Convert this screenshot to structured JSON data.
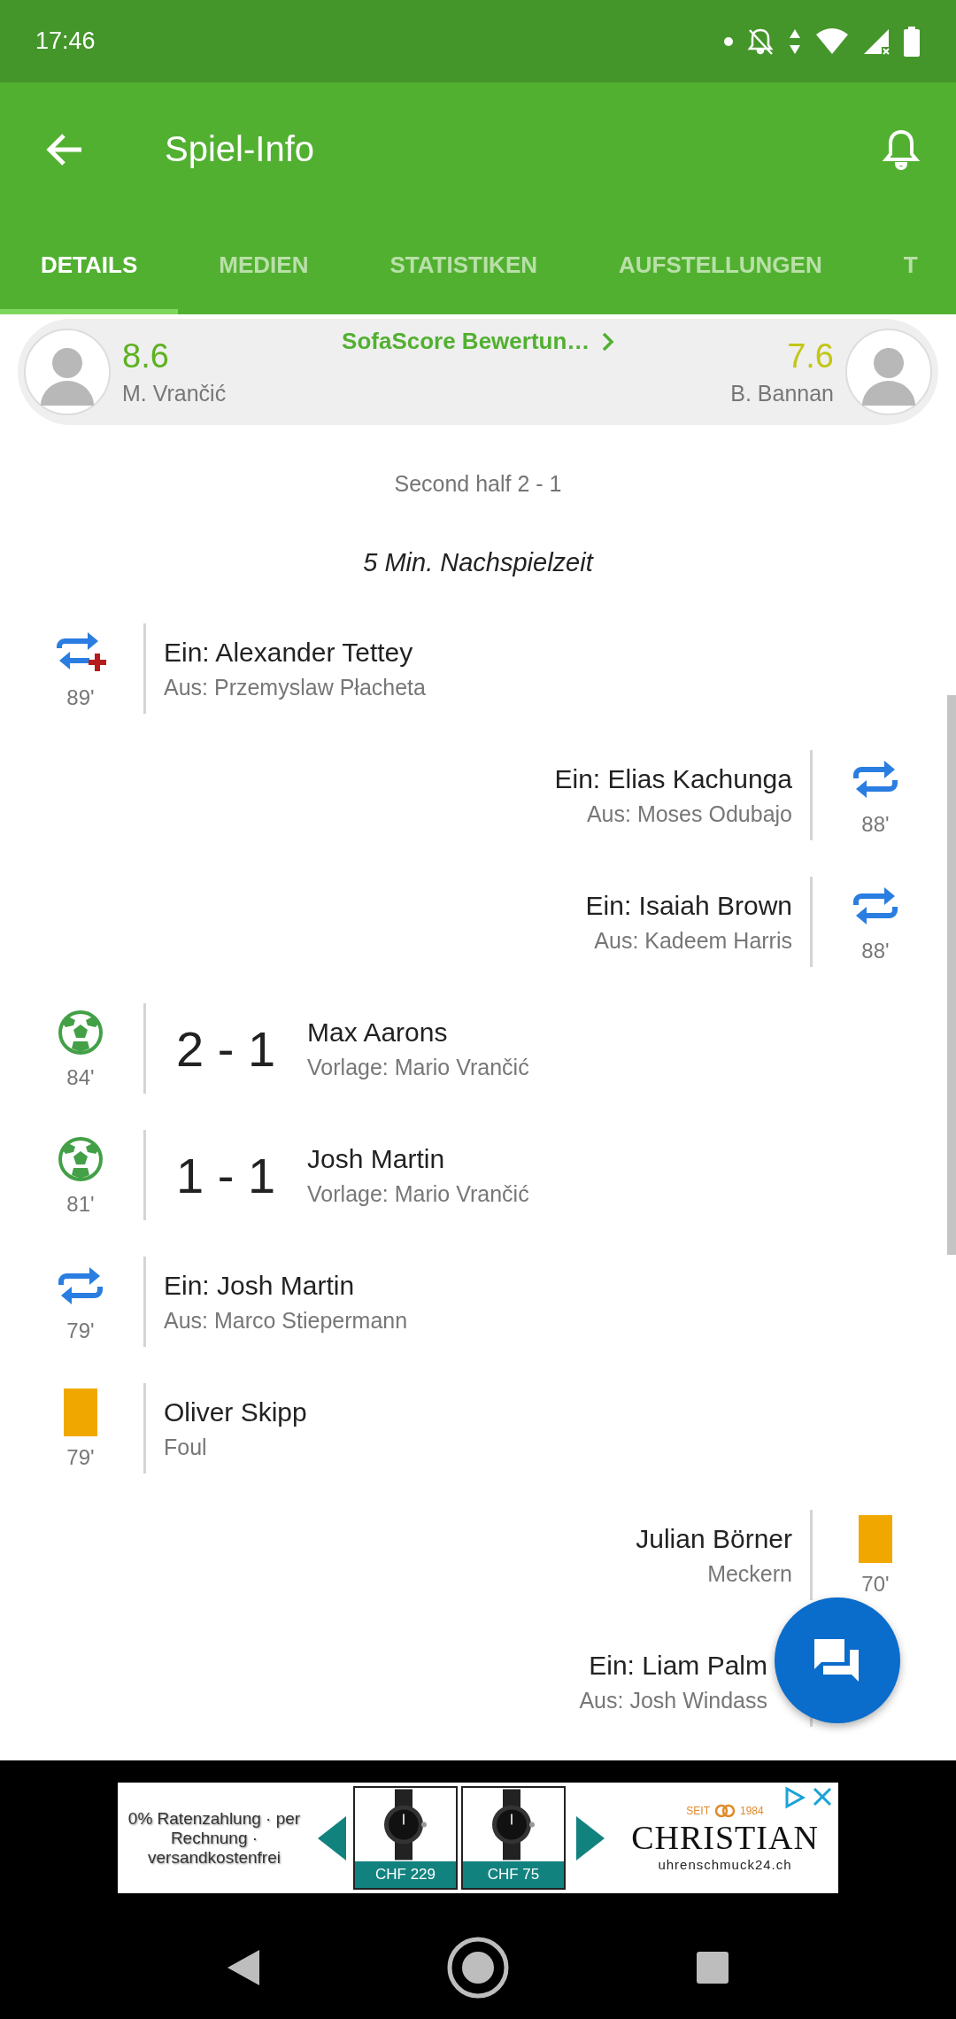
{
  "status_bar": {
    "time": "17:46"
  },
  "toolbar": {
    "title": "Spiel-Info"
  },
  "tabs": [
    {
      "label": "DETAILS",
      "selected": true
    },
    {
      "label": "MEDIEN",
      "selected": false
    },
    {
      "label": "STATISTIKEN",
      "selected": false
    },
    {
      "label": "AUFSTELLUNGEN",
      "selected": false
    },
    {
      "label": "T",
      "selected": false
    }
  ],
  "rating_card": {
    "link": "SofaScore Bewertun…",
    "players": [
      {
        "rating": "8.6",
        "name": "M. Vrančić",
        "color": "#5cb21f"
      },
      {
        "rating": "7.6",
        "name": "B. Bannan",
        "color": "#c3c614"
      }
    ]
  },
  "period": "Second half 2 - 1",
  "added_time": "5 Min. Nachspielzeit",
  "events": [
    {
      "away": false,
      "kind": "substitution_injury",
      "minute": "89'",
      "title": "Ein: Alexander Tettey",
      "subtitle": "Aus: Przemyslaw Płacheta"
    },
    {
      "away": true,
      "kind": "substitution",
      "minute": "88'",
      "title": "Ein: Elias Kachunga",
      "subtitle": "Aus: Moses Odubajo"
    },
    {
      "away": true,
      "kind": "substitution",
      "minute": "88'",
      "title": "Ein: Isaiah Brown",
      "subtitle": "Aus: Kadeem Harris"
    },
    {
      "away": false,
      "kind": "goal",
      "minute": "84'",
      "score": "2 - 1",
      "title": "Max Aarons",
      "subtitle": "Vorlage: Mario Vrančić"
    },
    {
      "away": false,
      "kind": "goal",
      "minute": "81'",
      "score": "1 - 1",
      "title": "Josh Martin",
      "subtitle": "Vorlage: Mario Vrančić"
    },
    {
      "away": false,
      "kind": "substitution",
      "minute": "79'",
      "title": "Ein: Josh Martin",
      "subtitle": "Aus: Marco Stiepermann"
    },
    {
      "away": false,
      "kind": "yellow_card",
      "minute": "79'",
      "title": "Oliver Skipp",
      "subtitle": "Foul"
    },
    {
      "away": true,
      "kind": "yellow_card",
      "minute": "70'",
      "title": "Julian Börner",
      "subtitle": "Meckern"
    },
    {
      "away": true,
      "kind": "substitution",
      "title": "Ein: Liam Palm",
      "subtitle": "Aus: Josh Windass"
    }
  ],
  "ad": {
    "text": "0% Ratenzahlung · per Rechnung · versandkostenfrei",
    "products": [
      {
        "kind": "picture",
        "price": "CHF 229"
      },
      {
        "kind": "picture",
        "price": "CHF 75"
      }
    ],
    "brand": {
      "since": "SEIT",
      "year": "1984",
      "name": "CHRISTIAN",
      "url": "uhrenschmuck24.ch"
    }
  }
}
